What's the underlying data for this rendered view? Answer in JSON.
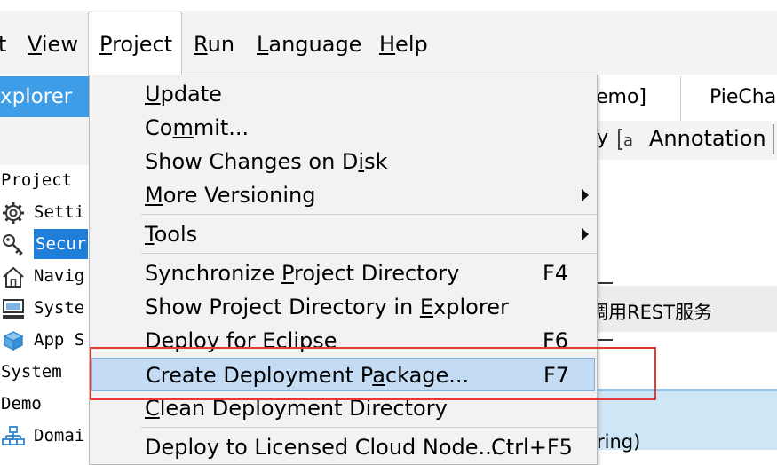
{
  "menubar": {
    "items": [
      {
        "text": "t"
      },
      {
        "u": "V",
        "rest": "iew"
      },
      {
        "u": "P",
        "rest": "roject"
      },
      {
        "u": "R",
        "rest": "un"
      },
      {
        "u": "L",
        "rest": "anguage"
      },
      {
        "u": "H",
        "rest": "elp"
      }
    ]
  },
  "explorer": {
    "tab_label": "xplorer",
    "tree": [
      {
        "label": "Project ",
        "icon": "none"
      },
      {
        "label": "Setti",
        "icon": "gear-icon"
      },
      {
        "label": "Secur",
        "icon": "key-icon",
        "selected": true
      },
      {
        "label": "Navig",
        "icon": "home-icon"
      },
      {
        "label": "Syste",
        "icon": "system-icon"
      },
      {
        "label": "App S",
        "icon": "cube-icon"
      },
      {
        "label": "System",
        "icon": "none"
      },
      {
        "label": "Demo",
        "icon": "none"
      },
      {
        "label": "Domai",
        "icon": "domain-icon"
      }
    ]
  },
  "editor": {
    "tab1": "emo]",
    "tab2": "PieChar",
    "toolbar_fragment": "y",
    "annotation_label": "Annotation",
    "row_text": "调用REST服务",
    "bottom_fragment": "ring)"
  },
  "dropdown": {
    "items": [
      {
        "pre": "",
        "u": "U",
        "post": "pdate",
        "shortcut": "",
        "submenu": false
      },
      {
        "pre": "Co",
        "u": "m",
        "post": "mit...",
        "shortcut": "",
        "submenu": false
      },
      {
        "pre": "Show Changes on D",
        "u": "i",
        "post": "sk",
        "shortcut": "",
        "submenu": false
      },
      {
        "pre": "",
        "u": "M",
        "post": "ore Versioning",
        "shortcut": "",
        "submenu": true
      },
      {
        "pre": "",
        "u": "T",
        "post": "ools",
        "shortcut": "",
        "submenu": true
      },
      {
        "pre": "Synchronize ",
        "u": "P",
        "post": "roject Directory",
        "shortcut": "F4",
        "submenu": false
      },
      {
        "pre": "Show Project Directory in ",
        "u": "E",
        "post": "xplorer",
        "shortcut": "",
        "submenu": false
      },
      {
        "pre": "Deploy for Eclipse",
        "u": "",
        "post": "",
        "shortcut": "F6",
        "submenu": false
      },
      {
        "pre": "Create Deployment P",
        "u": "a",
        "post": "ckage...",
        "shortcut": "F7",
        "submenu": false,
        "highlighted": true
      },
      {
        "pre": "",
        "u": "C",
        "post": "lean Deployment Directory",
        "shortcut": "",
        "submenu": false
      },
      {
        "pre": "Deploy to Licensed Cloud Node...",
        "u": "",
        "post": "",
        "shortcut": "Ctrl+F5",
        "submenu": false
      }
    ]
  },
  "colors": {
    "accent": "#3e9de6",
    "highlight": "#c3dcf3",
    "annotation_box": "#e53935"
  }
}
